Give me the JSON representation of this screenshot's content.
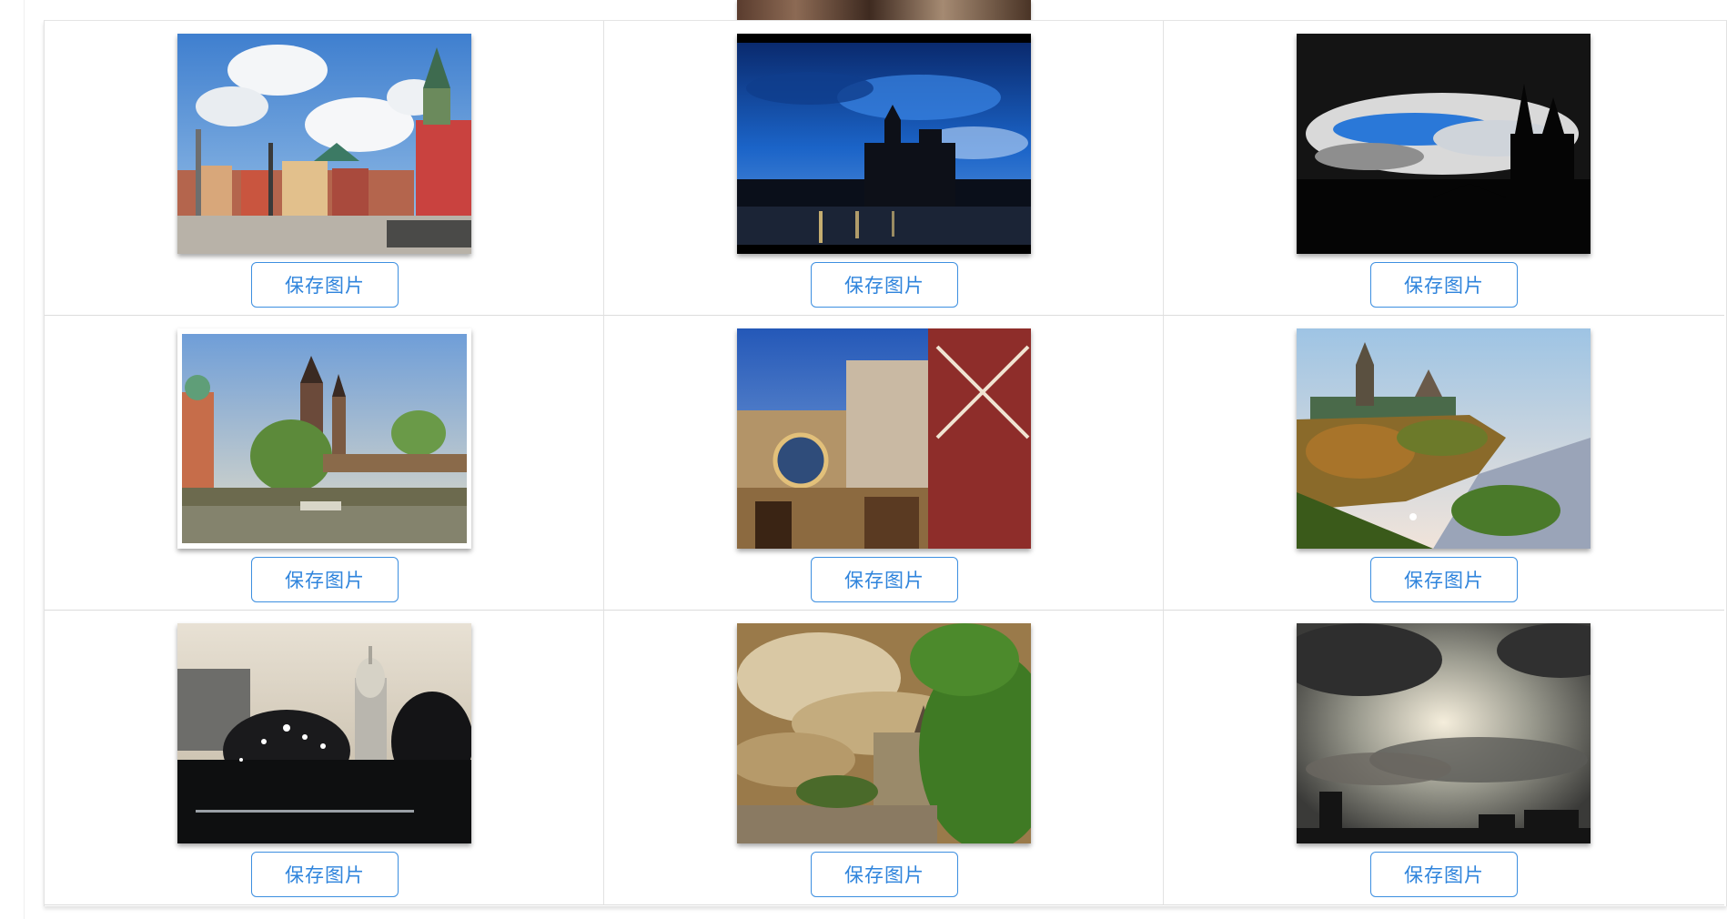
{
  "gallery": {
    "save_label": "保存图片",
    "items": [
      {
        "id": 1,
        "scene": "old-town-square-red-tower"
      },
      {
        "id": 2,
        "scene": "blue-night-cathedral"
      },
      {
        "id": 3,
        "scene": "dark-gothic-silhouette"
      },
      {
        "id": 4,
        "scene": "river-bridge-towers"
      },
      {
        "id": 5,
        "scene": "astronomical-clock-street"
      },
      {
        "id": 6,
        "scene": "parliament-hill-river"
      },
      {
        "id": 7,
        "scene": "capitol-dome-night"
      },
      {
        "id": 8,
        "scene": "cloudy-chateau-trees"
      },
      {
        "id": 9,
        "scene": "sunset-clouds-skyline"
      }
    ]
  },
  "colors": {
    "accent": "#2f84dc",
    "border": "#e2e2e2"
  }
}
